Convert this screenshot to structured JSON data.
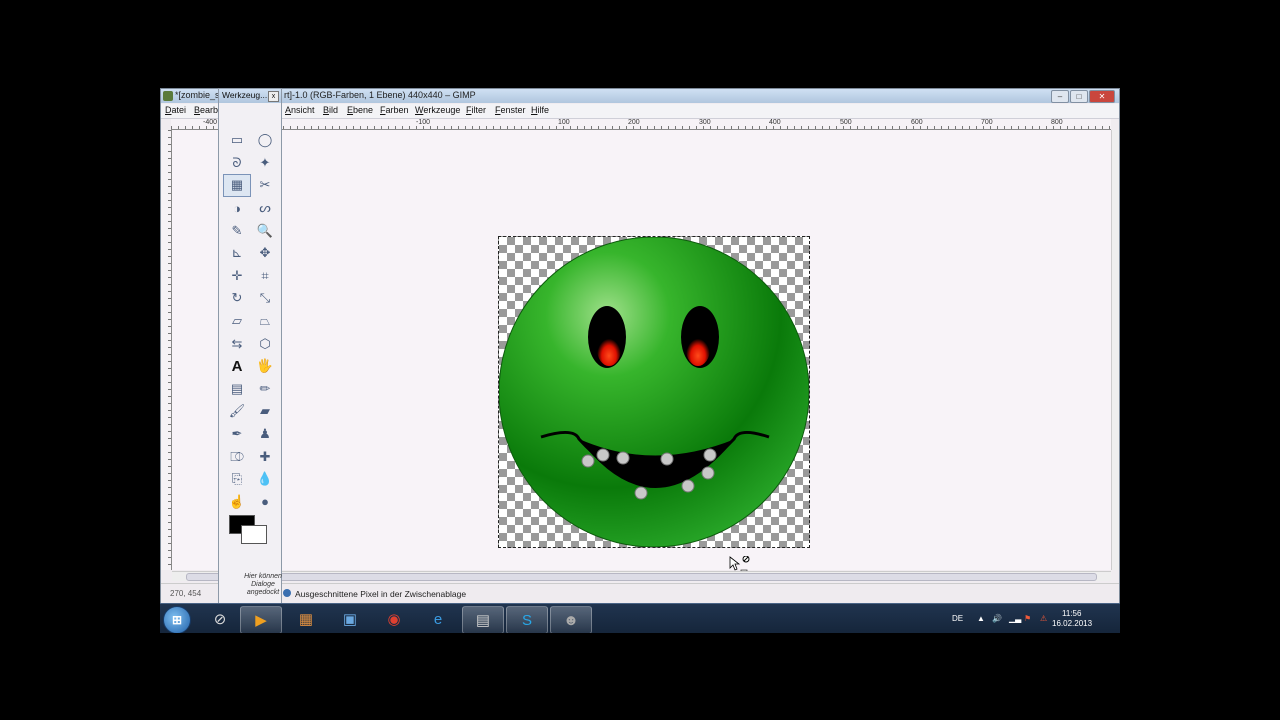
{
  "window": {
    "title_left": "*[zombie_s",
    "title_right": "rt]-1.0 (RGB-Farben, 1 Ebene) 440x440 – GIMP"
  },
  "menubar": {
    "items": [
      "Datei",
      "Bearbe",
      "Ansicht",
      "Bild",
      "Ebene",
      "Farben",
      "Werkzeuge",
      "Filter",
      "Fenster",
      "Hilfe"
    ]
  },
  "ruler": {
    "labels": [
      "-400",
      "-100",
      "100",
      "200",
      "300",
      "400",
      "500",
      "600",
      "700",
      "800"
    ]
  },
  "toolbox": {
    "title": "Werkzeug...",
    "hint": "Hier können Dialoge angedockt",
    "tools": [
      "rect-select-icon",
      "ellipse-select-icon",
      "free-select-icon",
      "fuzzy-select-icon",
      "select-by-color-icon",
      "scissors-icon",
      "foreground-select-icon",
      "paths-icon",
      "color-picker-icon",
      "zoom-icon",
      "measure-icon",
      "move-icon",
      "align-icon",
      "crop-icon",
      "rotate-icon",
      "scale-icon",
      "shear-icon",
      "perspective-icon",
      "flip-icon",
      "cage-icon",
      "text-icon",
      "bucket-fill-icon",
      "blend-icon",
      "pencil-icon",
      "paintbrush-icon",
      "eraser-icon",
      "airbrush-icon",
      "ink-icon",
      "clone-icon",
      "heal-icon",
      "perspective-clone-icon",
      "blur-icon",
      "smudge-icon",
      "dodge-burn-icon"
    ],
    "active_tool": "select-by-color-icon",
    "foreground_color": "#000000",
    "background_color": "#ffffff"
  },
  "statusbar": {
    "coords": "270, 454",
    "message": "Ausgeschnittene Pixel in der Zwischenablage"
  },
  "tray": {
    "language": "DE",
    "time": "11:56",
    "date": "16.02.2013"
  },
  "colors": {
    "smiley_green": "#1e9a1e",
    "eye_red": "#ff2200",
    "taskbar": "#1b2d45"
  }
}
